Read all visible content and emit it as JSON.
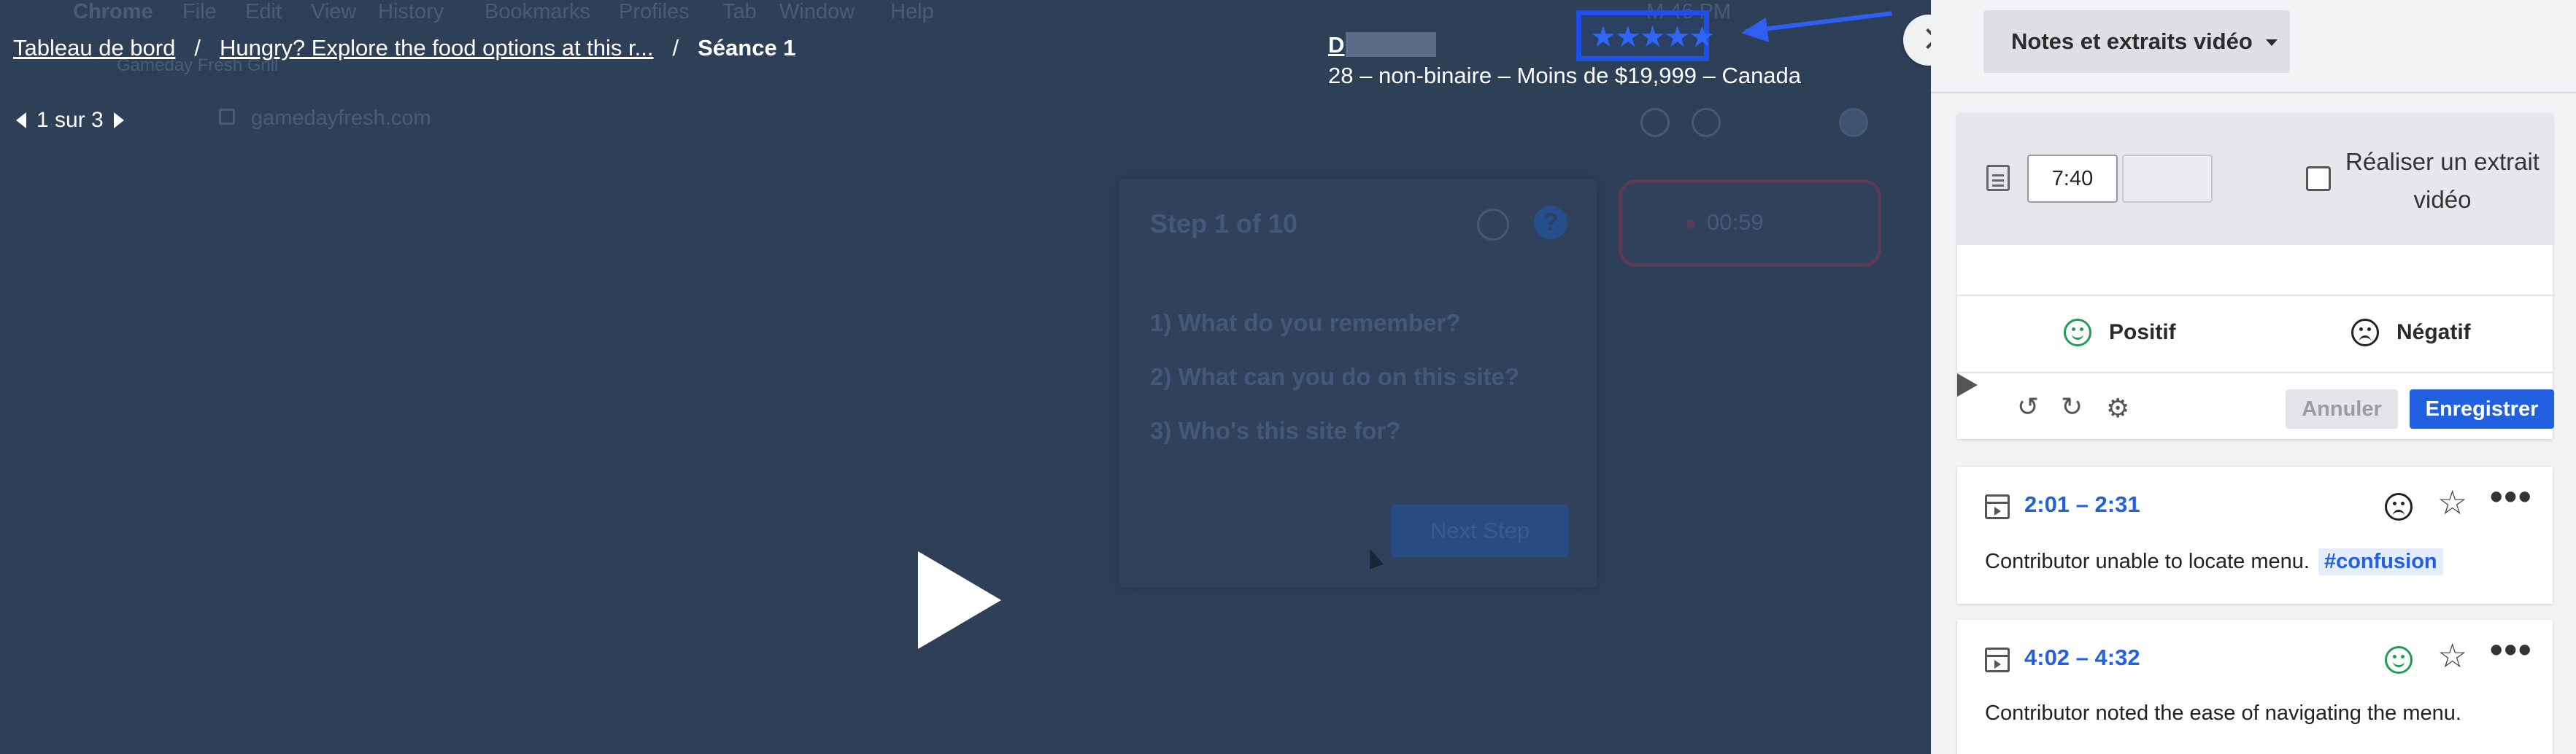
{
  "recording_menubar": [
    "Chrome",
    "File",
    "Edit",
    "View",
    "History",
    "Bookmarks",
    "Profiles",
    "Tab",
    "Window",
    "Help"
  ],
  "recording_clock": "M 46 PM",
  "recording_tab": "Gameday Fresh Grill",
  "recording_url": "gamedayfresh.com",
  "recording_timer": "00:59",
  "step_card": {
    "title": "Step 1 of 10",
    "questions": [
      "1) What do you remember?",
      "2) What can you do on this site?",
      "3) Who's this site for?"
    ],
    "next_label": "Next Step"
  },
  "breadcrumb": {
    "dashboard": "Tableau de bord",
    "test": "Hungry? Explore the food options at this r...",
    "session": "Séance 1",
    "separator": "/"
  },
  "pager": {
    "label": "1 sur 3"
  },
  "participant": {
    "name_visible": "D",
    "meta": "28 – non-binaire – Moins de $19,999 – Canada",
    "rating": 5,
    "rating_glyphs": "★★★★★"
  },
  "panel": {
    "dropdown_label": "Notes et extraits vidéo",
    "editor": {
      "time_start": "7:40",
      "time_end": "",
      "clip_label": "Réaliser un extrait vidéo",
      "clip_checked": false,
      "positive_label": "Positif",
      "negative_label": "Négatif",
      "cancel_label": "Annuler",
      "save_label": "Enregistrer"
    },
    "notes": [
      {
        "range": "2:01 – 2:31",
        "sentiment": "negative",
        "text": "Contributor unable to locate menu.",
        "tag": "#confusion"
      },
      {
        "range": "4:02 – 4:32",
        "sentiment": "positive",
        "text": "Contributor noted the ease of navigating the menu.",
        "tag": ""
      }
    ]
  },
  "colors": {
    "accent": "#2160e0",
    "annotation": "#1e4fe8",
    "video_bg": "#2e3f58",
    "positive": "#1e9e54"
  },
  "icons": {
    "play": "play-icon",
    "star": "star-icon",
    "more": "more-icon",
    "undo": "rewind-icon",
    "redo": "forward-icon",
    "settings": "gear-icon"
  }
}
